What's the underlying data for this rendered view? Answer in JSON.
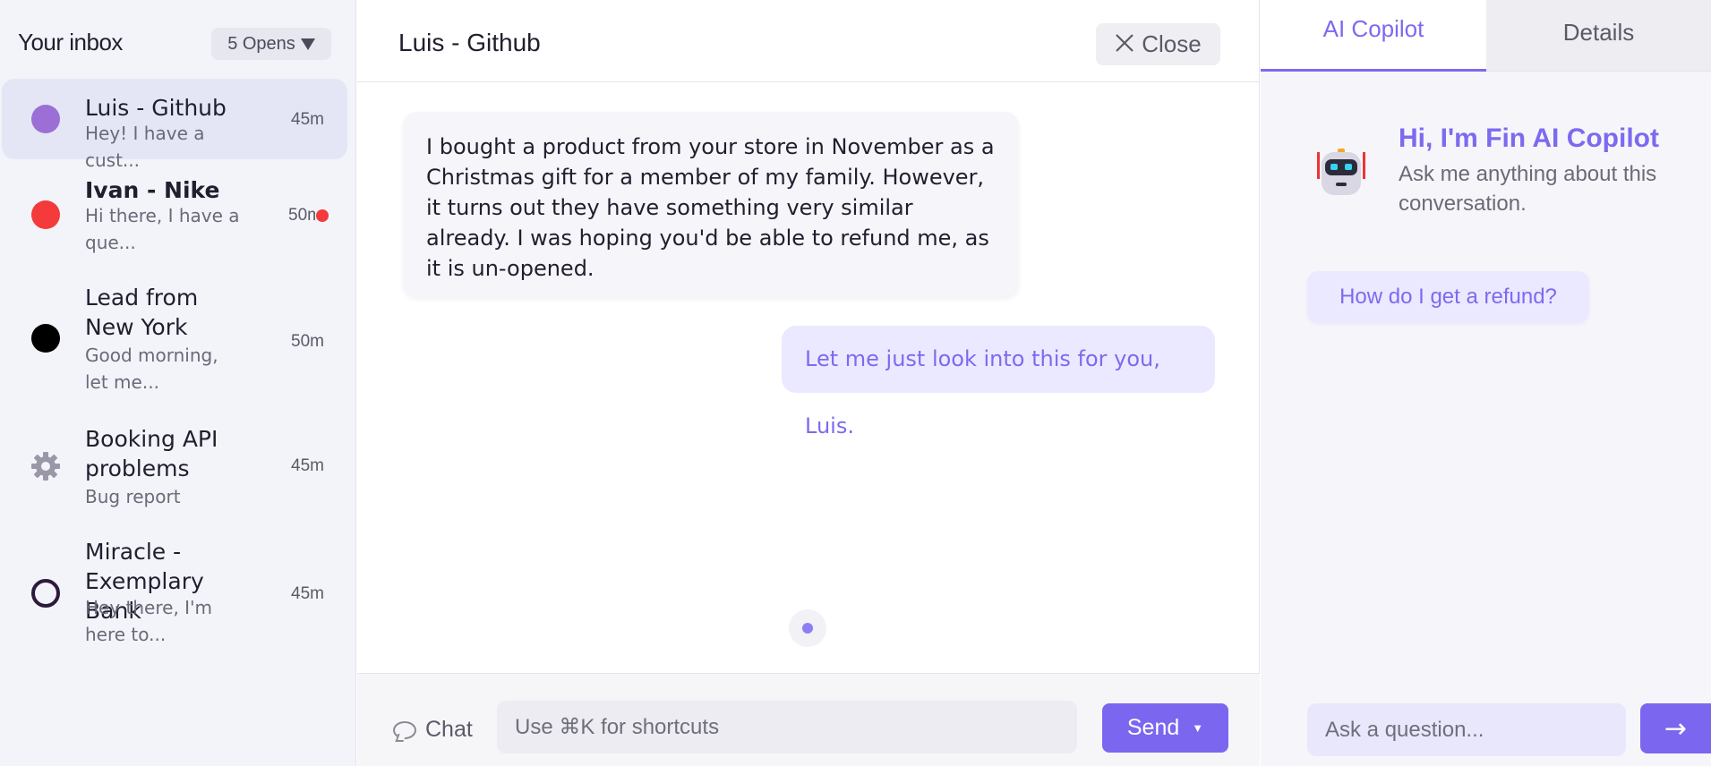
{
  "inbox": {
    "title": "Your inbox",
    "filter_label": "5 Opens",
    "conversations": [
      {
        "name": "Luis - Github",
        "preview": "Hey! I have a cust...",
        "time": "45m",
        "color": "#9b6fd6",
        "active": true,
        "bold": false
      },
      {
        "name": "Ivan - Nike",
        "preview": "Hi there, I have a que...",
        "time": "50m",
        "color": "#f43a3a",
        "bold": true,
        "unread": true
      },
      {
        "name": "Lead from New York",
        "preview": "Good morning, let me...",
        "time": "50m",
        "color": "#000000"
      },
      {
        "name": "Booking API problems",
        "preview": "Bug report",
        "time": "45m",
        "icon": "gear-icon",
        "color": "#9a98a8"
      },
      {
        "name": "Miracle - Exemplary Bank",
        "preview": "Hey there, I'm here to...",
        "time": "45m",
        "color": "#2c1b3d"
      }
    ]
  },
  "chat": {
    "title": "Luis - Github",
    "close_label": "Close",
    "messages": [
      {
        "from": "customer",
        "text": "I bought a product from your store in November as a Christmas gift for a member of my family. However, it turns out they have something very similar already. I was hoping you'd be able to refund me, as it is un-opened."
      },
      {
        "from": "agent",
        "text": "Let me just look into this for you, Luis."
      }
    ],
    "composer": {
      "mode_label": "Chat",
      "placeholder": "Use ⌘K for shortcuts",
      "send_label": "Send"
    }
  },
  "copilot": {
    "tabs": [
      {
        "label": "AI Copilot",
        "active": true
      },
      {
        "label": "Details",
        "active": false
      }
    ],
    "heading": "Hi, I'm Fin AI Copilot",
    "subtext": "Ask me anything about this conversation.",
    "suggestion": "How do I get a refund?",
    "ask_placeholder": "Ask a question...",
    "ask_send_icon": "→"
  },
  "colors": {
    "accent": "#7b66f0",
    "accent_text": "#7c6af0",
    "unread": "#f43a3a"
  }
}
